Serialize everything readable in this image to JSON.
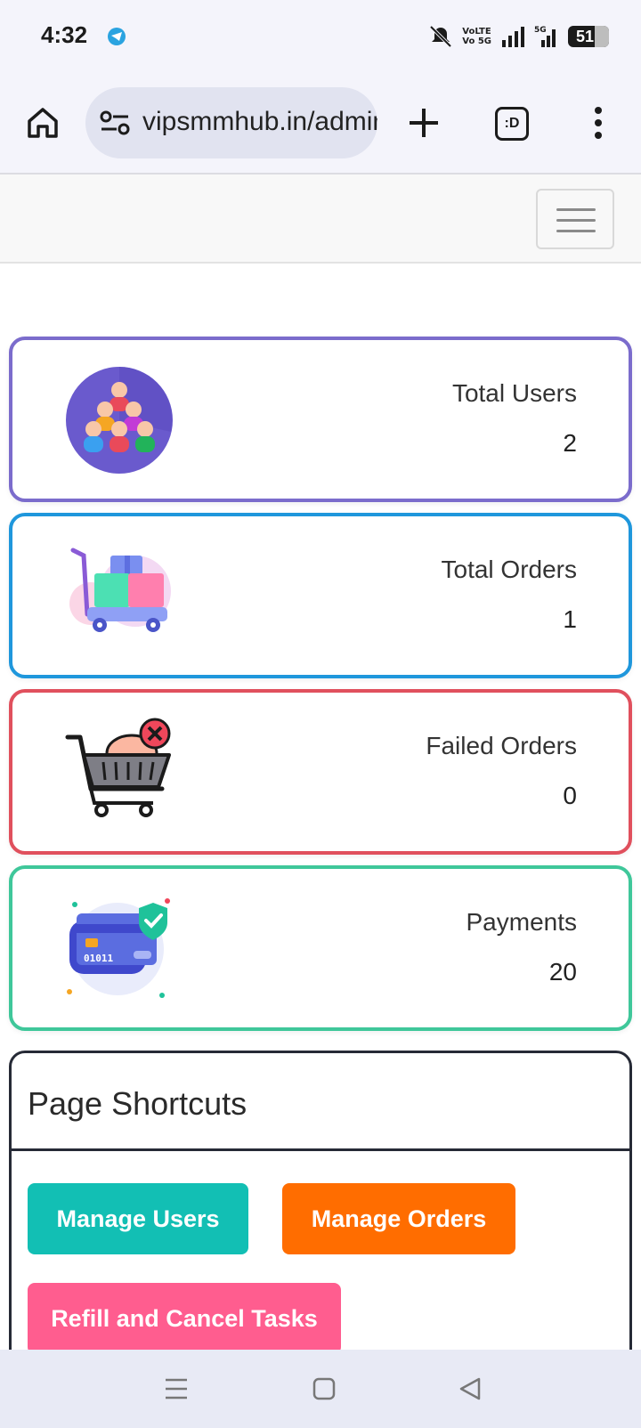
{
  "status_bar": {
    "time": "4:32",
    "network_text_top": "VoLTE",
    "network_text_bottom": "Vo 5G",
    "battery": "51",
    "icons": [
      "telegram-icon",
      "mute-icon",
      "signal-icon",
      "5g-signal-icon",
      "battery-icon"
    ]
  },
  "browser": {
    "url": "vipsmmhub.in/admin",
    "tabs_label": ":D",
    "icons": [
      "home-icon",
      "site-info-icon",
      "plus-icon",
      "tabs-icon",
      "more-vert-icon"
    ]
  },
  "navbar": {
    "toggler_icon": "hamburger-icon"
  },
  "cards": [
    {
      "label": "Total Users",
      "value": "2",
      "icon": "users-group-icon",
      "border_color": "#7b6ccc"
    },
    {
      "label": "Total Orders",
      "value": "1",
      "icon": "cart-boxes-icon",
      "border_color": "#1f97dc"
    },
    {
      "label": "Failed Orders",
      "value": "0",
      "icon": "failed-cart-icon",
      "border_color": "#e0505d"
    },
    {
      "label": "Payments",
      "value": "20",
      "icon": "credit-card-shield-icon",
      "border_color": "#3fc79a"
    }
  ],
  "shortcuts": {
    "title": "Page Shortcuts",
    "buttons": [
      {
        "label": "Manage Users",
        "color": "#12bfb4"
      },
      {
        "label": "Manage Orders",
        "color": "#ff6d00"
      },
      {
        "label": "Refill and Cancel Tasks",
        "color": "#ff5d8f"
      }
    ]
  },
  "system_nav": {
    "icons": [
      "recents-icon",
      "home-square-icon",
      "back-icon"
    ]
  }
}
